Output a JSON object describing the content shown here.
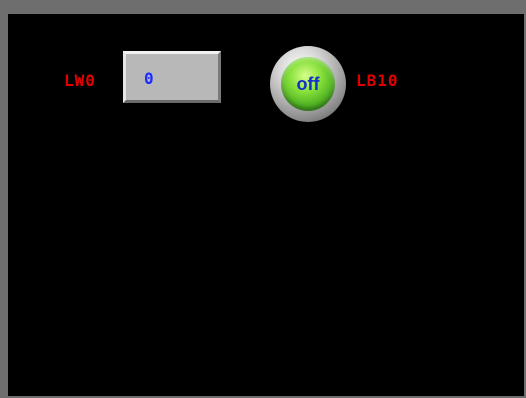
{
  "panel": {
    "word_tag": "LW0",
    "numeric_value": "0",
    "bit_tag": "LB10",
    "lamp_state": "off"
  },
  "colors": {
    "tag_label": "#e00000",
    "numeric_text": "#1a2cff",
    "lamp_text": "#1330c8",
    "screen_background": "#000000"
  }
}
